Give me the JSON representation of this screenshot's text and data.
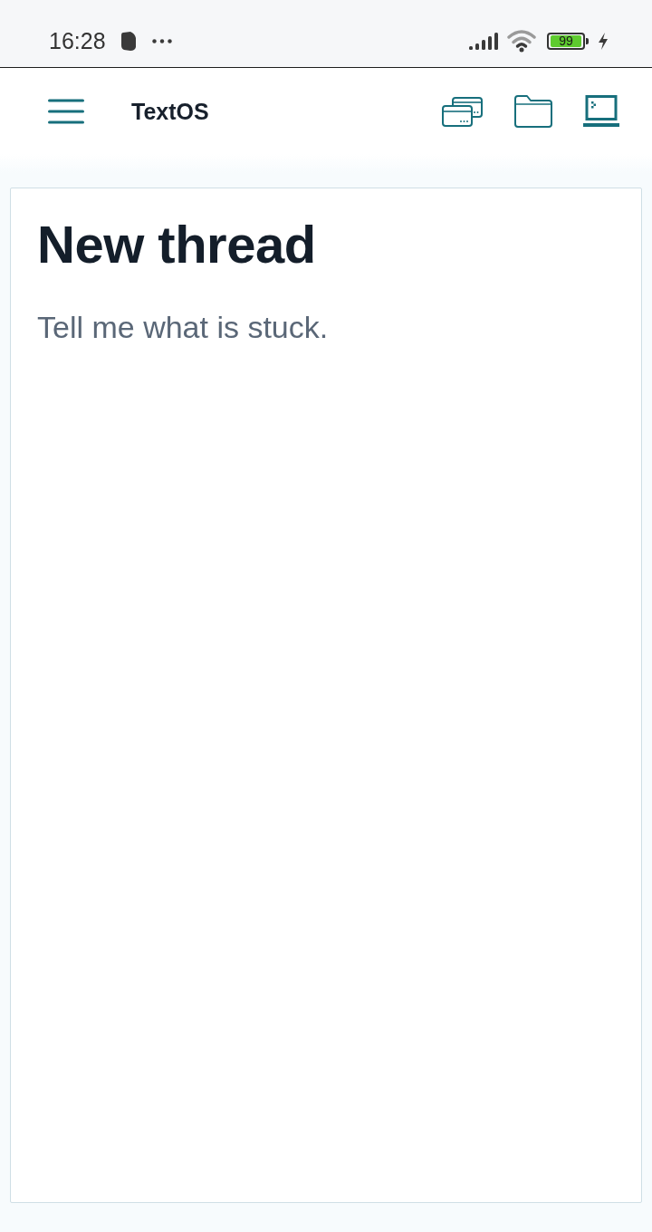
{
  "status_bar": {
    "time": "16:28",
    "battery": "99",
    "charging": true
  },
  "header": {
    "title": "TextOS"
  },
  "thread": {
    "title": "New thread",
    "prompt": "Tell me what is stuck."
  }
}
